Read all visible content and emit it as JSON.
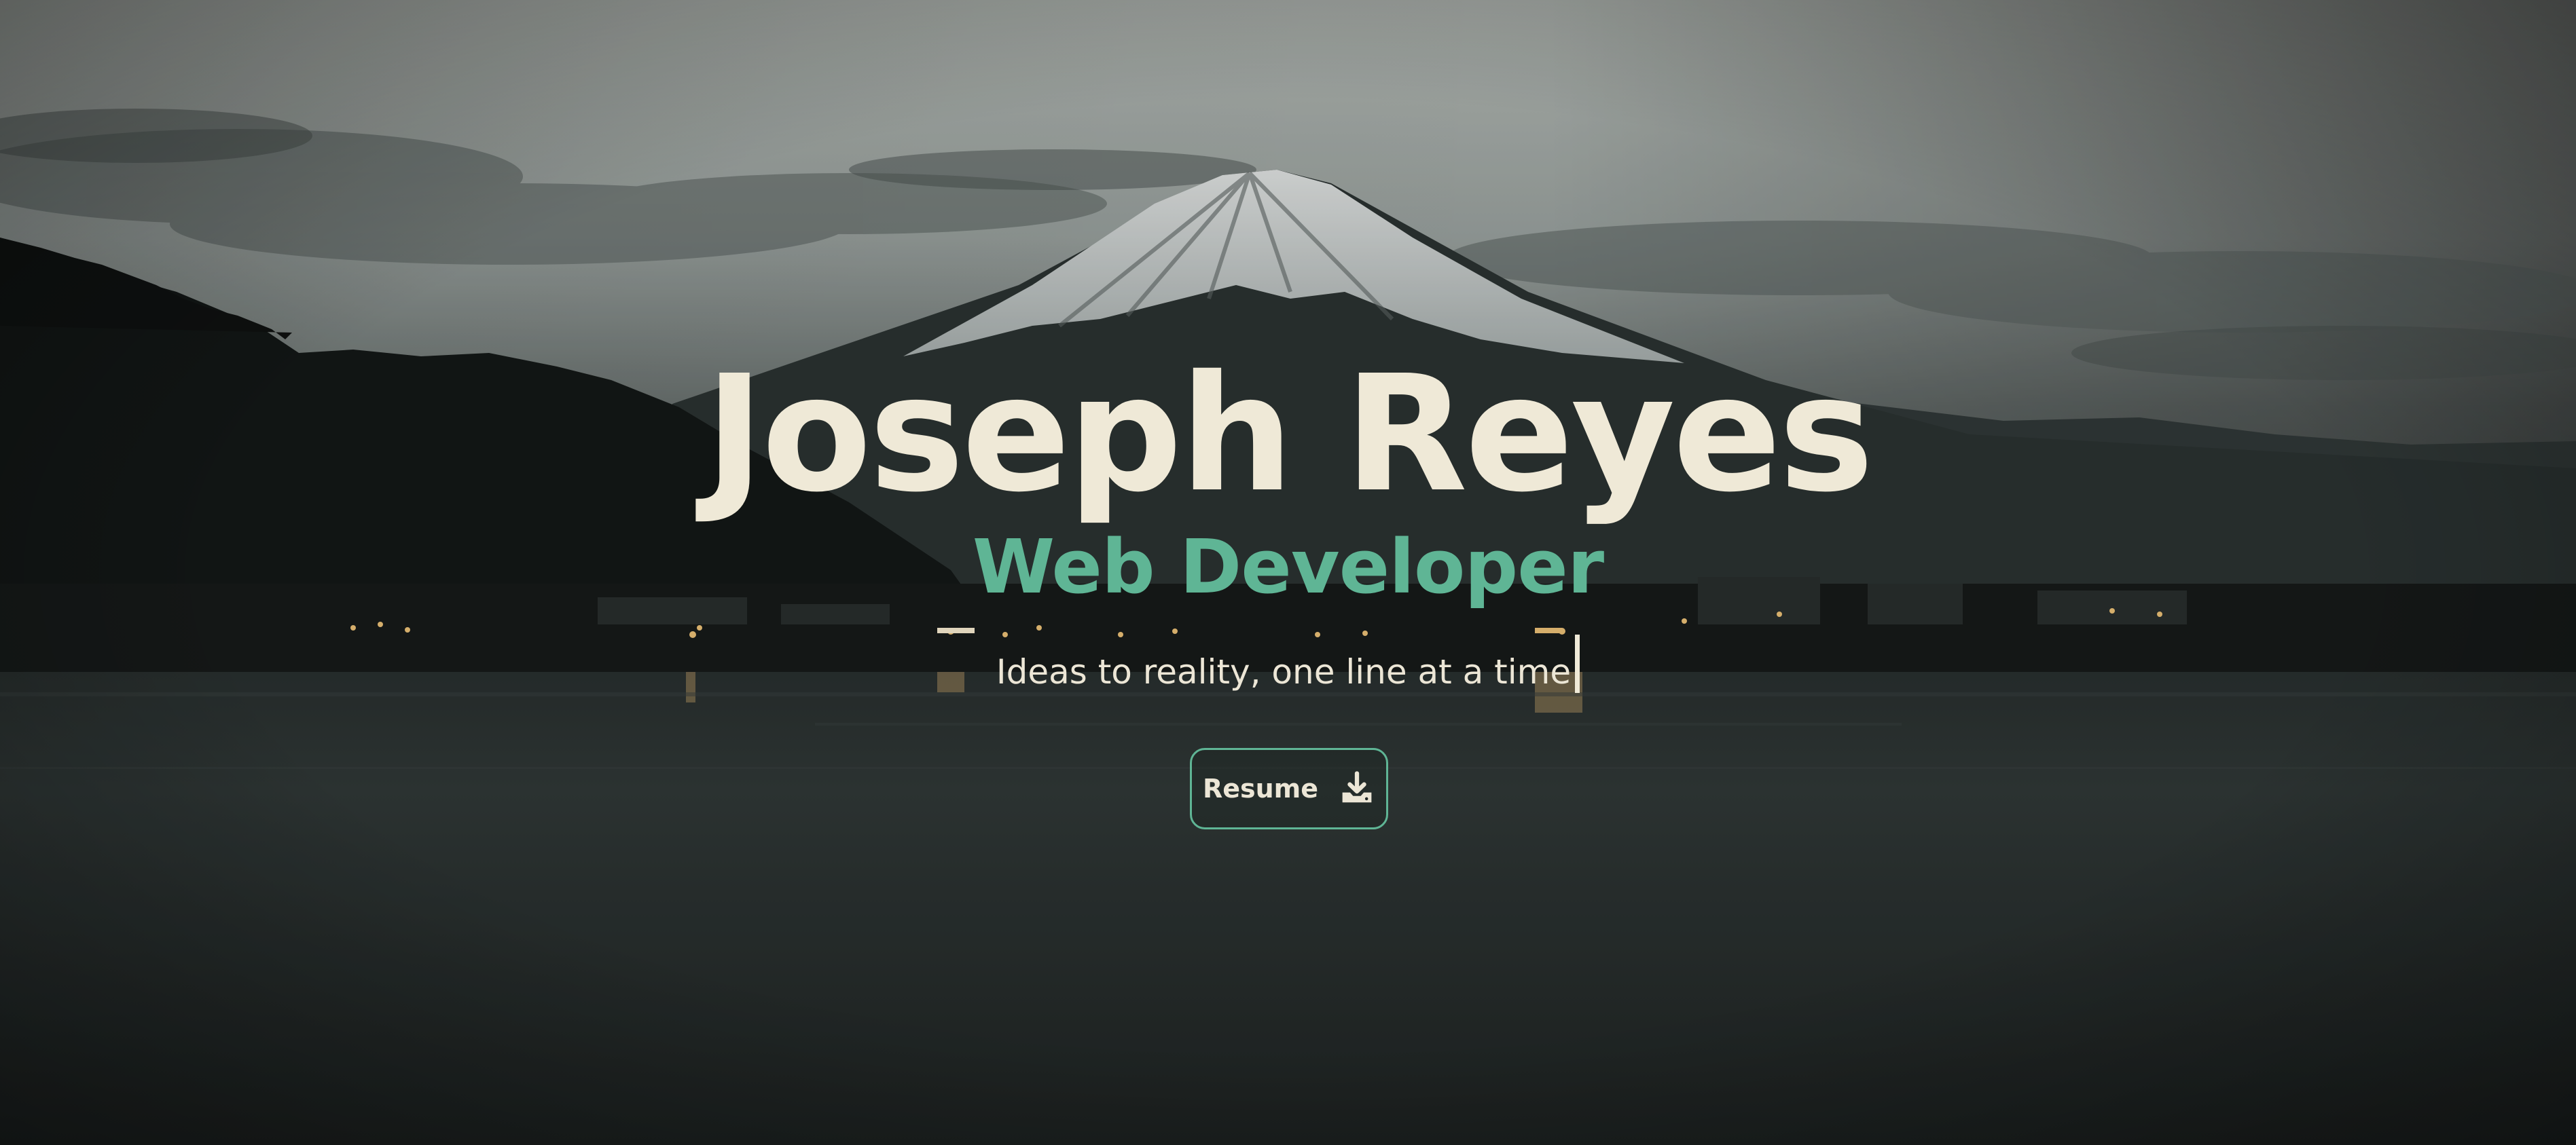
{
  "hero": {
    "name": "Joseph Reyes",
    "role": "Web Developer",
    "tagline": "Ideas to reality, one line at a time"
  },
  "resume_button": {
    "label": "Resume",
    "icon": "download-icon"
  },
  "colors": {
    "name_text": "#efe9d7",
    "accent": "#5fb595",
    "body_text": "#ece6d6"
  },
  "background": {
    "icon": "mountain-landscape-photo"
  }
}
